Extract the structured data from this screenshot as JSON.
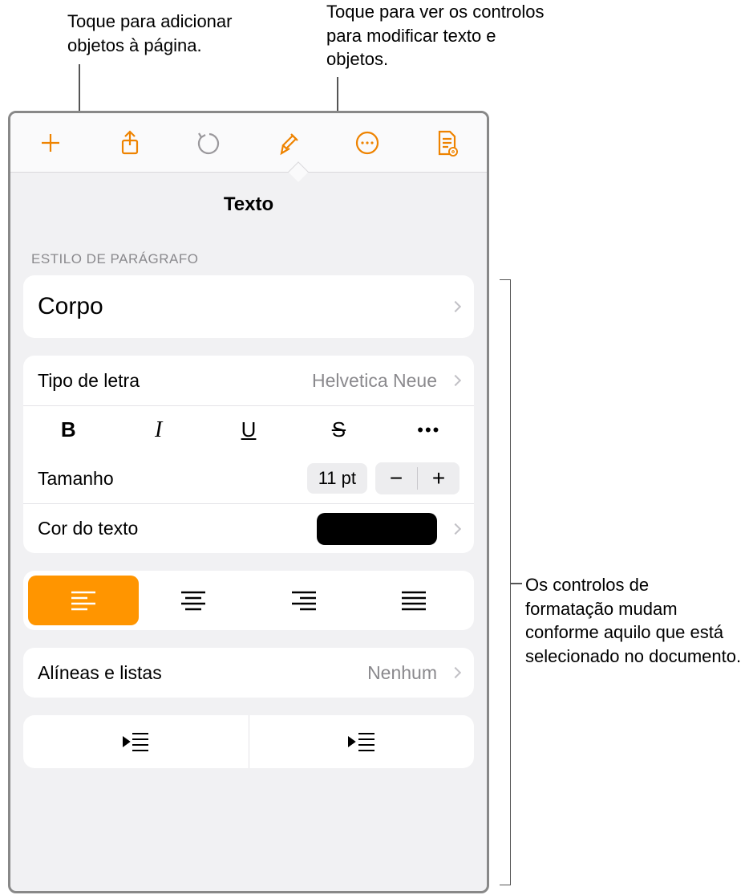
{
  "callouts": {
    "add": "Toque para adicionar objetos à página.",
    "format": "Toque para ver os controlos para modificar texto e objetos.",
    "controls": "Os controlos de formatação mudam conforme aquilo que está selecionado no documento."
  },
  "panel": {
    "title": "Texto",
    "paragraph_style_header": "ESTILO DE PARÁGRAFO",
    "style_name": "Corpo",
    "font_label": "Tipo de letra",
    "font_value": "Helvetica Neue",
    "size_label": "Tamanho",
    "size_value": "11 pt",
    "color_label": "Cor do texto",
    "color_value": "#000000",
    "bullets_label": "Alíneas e listas",
    "bullets_value": "Nenhum",
    "style_buttons": {
      "bold": "B",
      "italic": "I",
      "underline": "U",
      "strike": "S",
      "more": "•••"
    },
    "stepper": {
      "minus": "−",
      "plus": "+"
    },
    "alignment_active": "left"
  },
  "toolbar_icons": [
    "add-icon",
    "share-icon",
    "undo-icon",
    "format-icon",
    "more-icon",
    "document-icon"
  ]
}
